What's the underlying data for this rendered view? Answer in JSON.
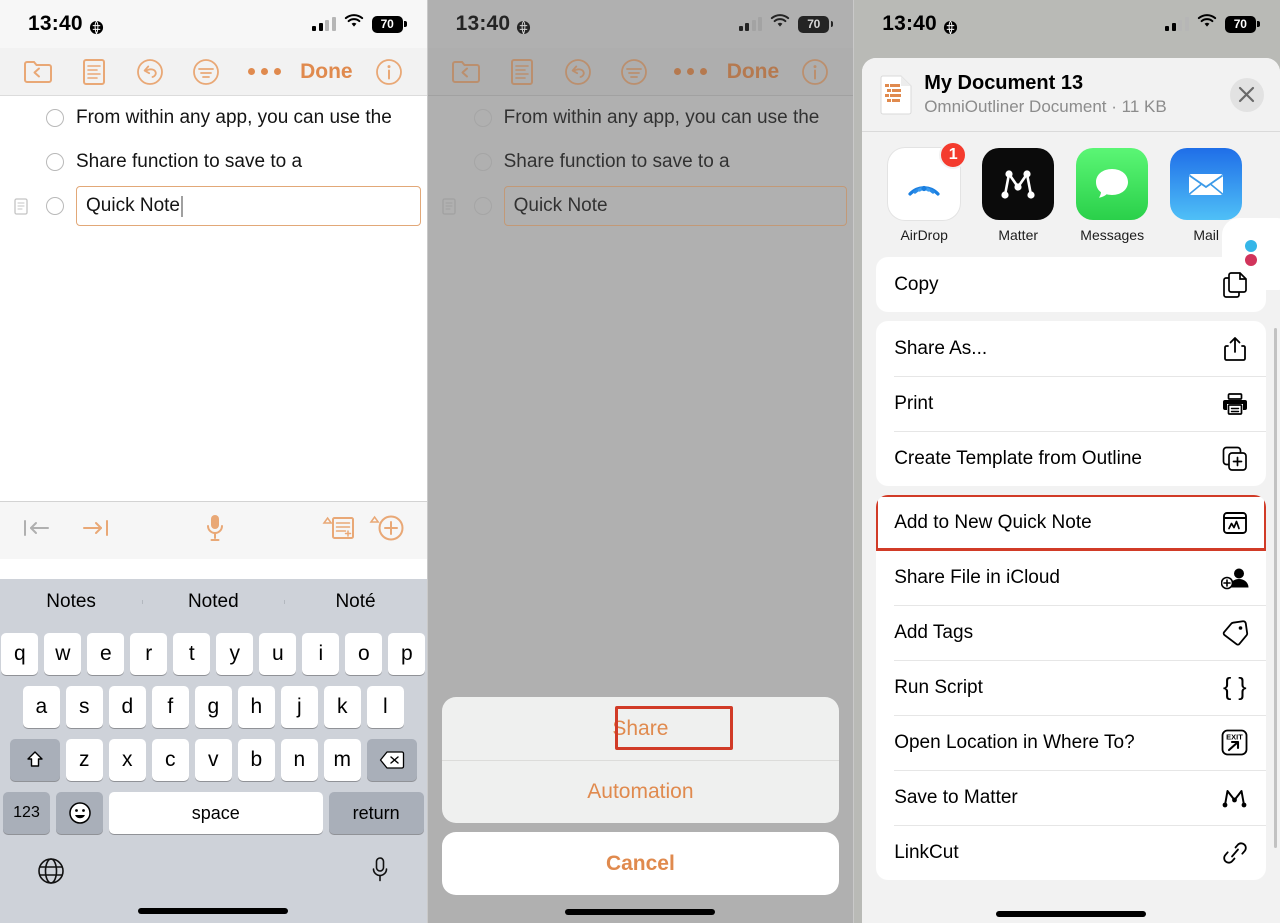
{
  "status_bar": {
    "time": "13:40",
    "battery": "70",
    "location_icon": "location-services-icon",
    "signal_icon": "cellular-bars-icon",
    "wifi_icon": "wifi-icon"
  },
  "outline": {
    "toolbar": {
      "back_to_documents": "folder-back-icon",
      "document_icon": "document-outline-icon",
      "undo": "undo-icon",
      "style": "style-filter-icon",
      "more_label": "•••",
      "done_label": "Done",
      "info": "info-icon",
      "accent_color": "#e08a4e",
      "highlight_color": "#d13b27"
    },
    "rows": [
      {
        "text": "From within any app, you can use the",
        "editing": false,
        "has_handle": false
      },
      {
        "text": "Share function to save to a",
        "editing": false,
        "has_handle": false
      },
      {
        "text": "Quick Note",
        "editing": true,
        "has_handle": true
      }
    ]
  },
  "keyboard_accessory": {
    "outdent_icon": "outdent-icon",
    "indent_icon": "indent-icon",
    "dictation_icon": "microphone-icon",
    "add_note_icon": "add-note-icon",
    "add_row_icon": "add-row-plus-icon"
  },
  "keyboard": {
    "predictions": [
      "Notes",
      "Noted",
      "Noté"
    ],
    "row1": [
      "q",
      "w",
      "e",
      "r",
      "t",
      "y",
      "u",
      "i",
      "o",
      "p"
    ],
    "row2": [
      "a",
      "s",
      "d",
      "f",
      "g",
      "h",
      "j",
      "k",
      "l"
    ],
    "row3": [
      "z",
      "x",
      "c",
      "v",
      "b",
      "n",
      "m"
    ],
    "shift_icon": "shift-icon",
    "backspace_icon": "backspace-icon",
    "numbers_label": "123",
    "emoji_icon": "emoji-icon",
    "space_label": "space",
    "return_label": "return",
    "globe_icon": "globe-icon",
    "mic_icon": "microphone-icon"
  },
  "action_sheet": {
    "items": [
      {
        "label": "Share",
        "highlighted": true
      },
      {
        "label": "Automation",
        "highlighted": false
      }
    ],
    "cancel_label": "Cancel"
  },
  "share_sheet": {
    "document": {
      "title": "My Document 13",
      "subtitle": "OmniOutliner Document · 11 KB",
      "icon": "omnioutliner-document-icon"
    },
    "close_icon": "close-icon",
    "apps": [
      {
        "name": "AirDrop",
        "icon": "airdrop-icon",
        "badge": "1"
      },
      {
        "name": "Matter",
        "icon": "matter-icon",
        "badge": null
      },
      {
        "name": "Messages",
        "icon": "messages-icon",
        "badge": null
      },
      {
        "name": "Mail",
        "icon": "mail-icon",
        "badge": null
      }
    ],
    "groups": [
      {
        "rows": [
          {
            "label": "Copy",
            "icon": "copy-icon",
            "highlighted": false
          }
        ]
      },
      {
        "rows": [
          {
            "label": "Share As...",
            "icon": "share-icon",
            "highlighted": false
          },
          {
            "label": "Print",
            "icon": "printer-icon",
            "highlighted": false
          },
          {
            "label": "Create Template from Outline",
            "icon": "template-icon",
            "highlighted": false
          }
        ]
      },
      {
        "rows": [
          {
            "label": "Add to New Quick Note",
            "icon": "quick-note-icon",
            "highlighted": true
          },
          {
            "label": "Share File in iCloud",
            "icon": "share-file-icloud-icon",
            "highlighted": false
          },
          {
            "label": "Add Tags",
            "icon": "tag-icon",
            "highlighted": false
          },
          {
            "label": "Run Script",
            "icon": "run-script-icon",
            "highlighted": false
          },
          {
            "label": "Open Location in Where To?",
            "icon": "exit-arrow-icon",
            "highlighted": false
          },
          {
            "label": "Save to Matter",
            "icon": "matter-icon",
            "highlighted": false
          },
          {
            "label": "LinkCut",
            "icon": "link-icon",
            "highlighted": false
          }
        ]
      }
    ]
  }
}
